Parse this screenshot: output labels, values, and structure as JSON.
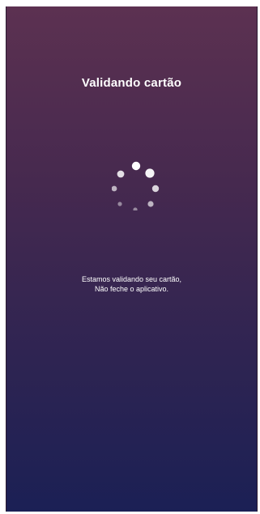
{
  "screen": {
    "title": "Validando cartão",
    "spinner_icon": "loading-spinner-icon",
    "message_line1": "Estamos validando seu cartão,",
    "message_line2": "Não feche o aplicativo."
  },
  "colors": {
    "gradient_top": "#5c3151",
    "gradient_bottom": "#1b2055",
    "text": "#ffffff"
  }
}
